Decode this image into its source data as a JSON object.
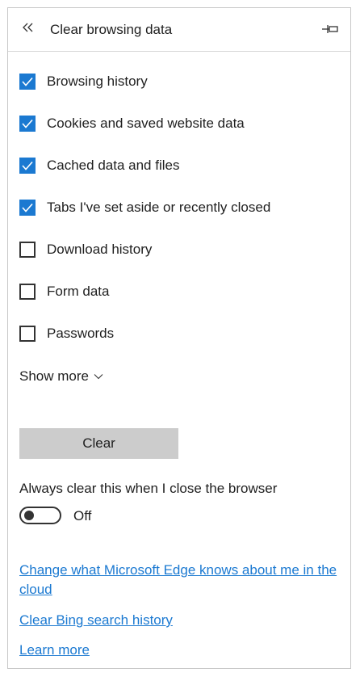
{
  "header": {
    "title": "Clear browsing data",
    "back_icon": "double-chevron-left-icon",
    "pin_icon": "pin-icon"
  },
  "options": [
    {
      "label": "Browsing history",
      "checked": true
    },
    {
      "label": "Cookies and saved website data",
      "checked": true
    },
    {
      "label": "Cached data and files",
      "checked": true
    },
    {
      "label": "Tabs I've set aside or recently closed",
      "checked": true
    },
    {
      "label": "Download history",
      "checked": false
    },
    {
      "label": "Form data",
      "checked": false
    },
    {
      "label": "Passwords",
      "checked": false
    }
  ],
  "show_more": {
    "label": "Show more",
    "icon": "chevron-down-icon"
  },
  "clear_button": {
    "label": "Clear"
  },
  "always_clear": {
    "label": "Always clear this when I close the browser",
    "toggle_on": false,
    "state_label": "Off"
  },
  "links": [
    {
      "label": "Change what Microsoft Edge knows about me in the cloud"
    },
    {
      "label": "Clear Bing search history"
    },
    {
      "label": "Learn more"
    }
  ],
  "colors": {
    "accent": "#1b79d1",
    "button_bg": "#cccccc",
    "border": "#c8c8c8",
    "text": "#1f1f1f"
  }
}
